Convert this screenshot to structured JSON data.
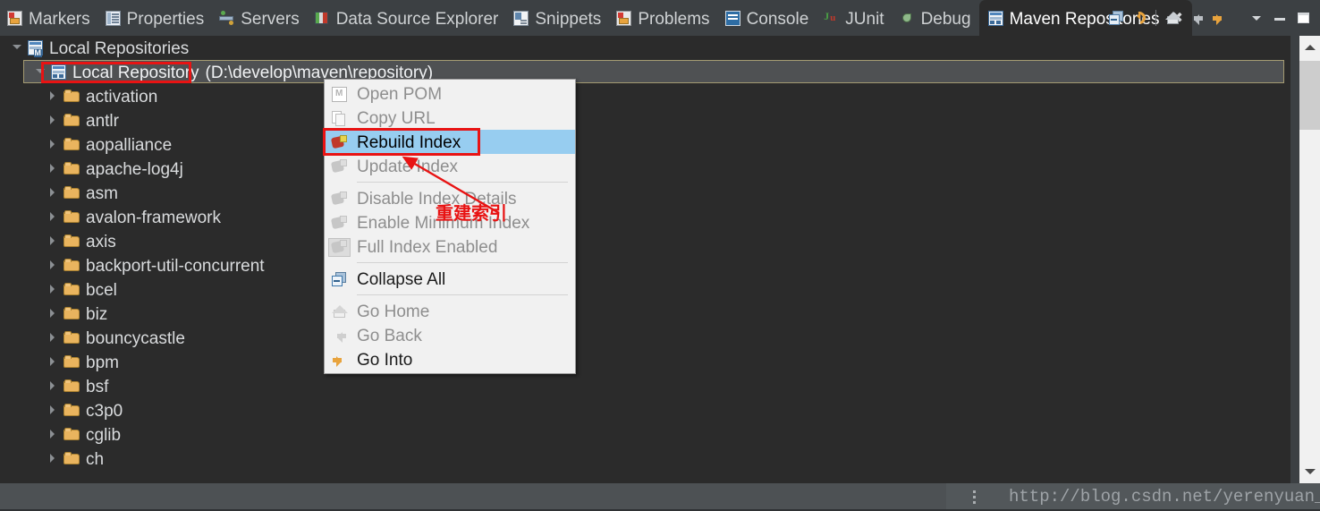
{
  "window": {
    "theme_bg": "#2b2b2b",
    "chrome_bg": "#3c4043",
    "accent_orange": "#e8a33d",
    "selection_blue": "#97cdf0",
    "annotation_red": "#e81313"
  },
  "tabbar": {
    "tabs": [
      {
        "label": "Markers",
        "icon": "markers-icon",
        "active": false
      },
      {
        "label": "Properties",
        "icon": "properties-icon",
        "active": false
      },
      {
        "label": "Servers",
        "icon": "servers-icon",
        "active": false
      },
      {
        "label": "Data Source Explorer",
        "icon": "data-source-explorer-icon",
        "active": false
      },
      {
        "label": "Snippets",
        "icon": "snippets-icon",
        "active": false
      },
      {
        "label": "Problems",
        "icon": "problems-icon",
        "active": false
      },
      {
        "label": "Console",
        "icon": "console-icon",
        "active": false
      },
      {
        "label": "JUnit",
        "icon": "junit-icon",
        "active": false
      },
      {
        "label": "Debug",
        "icon": "debug-icon",
        "active": false
      },
      {
        "label": "Maven Repositories",
        "icon": "maven-repositories-icon",
        "active": true,
        "close_glyph": "✖"
      }
    ]
  },
  "view_toolbar": {
    "buttons": [
      {
        "name": "collapse-all-button",
        "icon": "collapse-all-icon"
      },
      {
        "name": "refresh-button",
        "icon": "refresh-icon"
      },
      {
        "name": "go-home-button",
        "icon": "home-icon"
      },
      {
        "name": "back-button",
        "icon": "arrow-left-icon"
      },
      {
        "name": "forward-button",
        "icon": "arrow-right-icon"
      },
      {
        "name": "view-menu-button",
        "icon": "chevron-down-icon"
      },
      {
        "name": "minimize-button",
        "icon": "minimize-icon"
      },
      {
        "name": "maximize-button",
        "icon": "maximize-icon"
      }
    ]
  },
  "tree": {
    "root": {
      "label": "Local Repositories",
      "icon": "maven-repositories-icon",
      "expanded": true
    },
    "repository": {
      "label": "Local Repository",
      "path": "(D:\\develop\\maven\\repository)",
      "icon": "repository-icon",
      "expanded": true,
      "selected": true,
      "annotated": true
    },
    "children": [
      {
        "label": "activation"
      },
      {
        "label": "antlr"
      },
      {
        "label": "aopalliance"
      },
      {
        "label": "apache-log4j"
      },
      {
        "label": "asm"
      },
      {
        "label": "avalon-framework"
      },
      {
        "label": "axis"
      },
      {
        "label": "backport-util-concurrent"
      },
      {
        "label": "bcel"
      },
      {
        "label": "biz"
      },
      {
        "label": "bouncycastle"
      },
      {
        "label": "bpm"
      },
      {
        "label": "bsf"
      },
      {
        "label": "c3p0"
      },
      {
        "label": "cglib"
      },
      {
        "label": "ch"
      }
    ]
  },
  "context_menu": {
    "items": [
      {
        "label": "Open POM",
        "icon": "open-pom-icon",
        "enabled": false,
        "selected": false
      },
      {
        "label": "Copy URL",
        "icon": "copy-url-icon",
        "enabled": false,
        "selected": false
      },
      {
        "separator_after": false,
        "label": "Rebuild Index",
        "icon": "rebuild-index-icon",
        "enabled": true,
        "selected": true,
        "annotated": true
      },
      {
        "label": "Update Index",
        "icon": "update-index-icon",
        "enabled": false,
        "selected": false
      },
      {
        "label": "Disable Index Details",
        "icon": "index-icon",
        "enabled": false,
        "selected": false
      },
      {
        "label": "Enable Minimum Index",
        "icon": "index-icon",
        "enabled": false,
        "selected": false
      },
      {
        "label": "Full Index Enabled",
        "icon": "index-icon",
        "enabled": false,
        "selected": false,
        "checked": true
      },
      {
        "label": "Collapse All",
        "icon": "collapse-all-icon",
        "enabled": true,
        "selected": false
      },
      {
        "label": "Go Home",
        "icon": "home-icon",
        "enabled": false,
        "selected": false
      },
      {
        "label": "Go Back",
        "icon": "arrow-left-icon",
        "enabled": false,
        "selected": false
      },
      {
        "label": "Go Into",
        "icon": "arrow-right-icon",
        "enabled": true,
        "selected": false
      }
    ]
  },
  "annotation": {
    "callout_text": "重建索引",
    "color": "#e81313"
  },
  "scrollbar": {
    "up_arrow": "▲",
    "down_arrow": "▼"
  },
  "statusbar": {
    "watermark": "http://blog.csdn.net/yerenyuan_pku"
  }
}
